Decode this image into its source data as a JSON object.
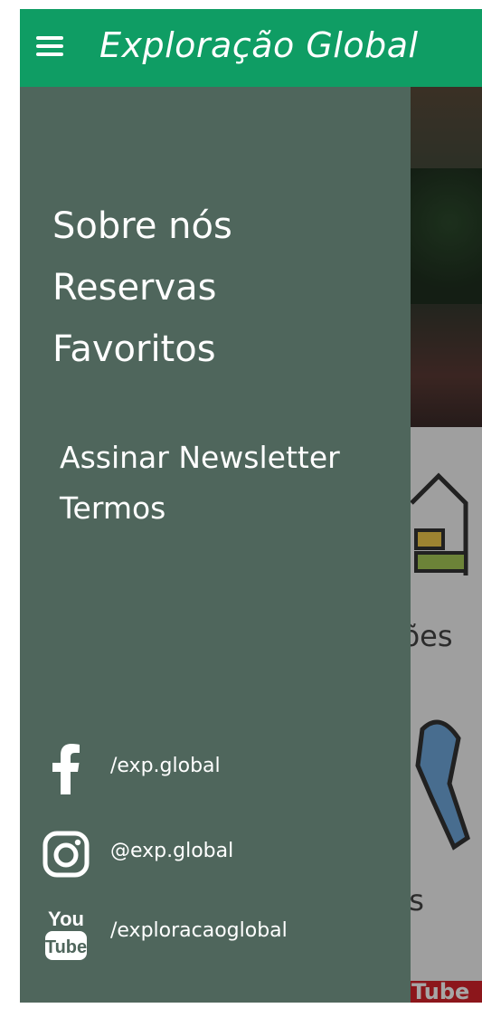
{
  "app": {
    "title": "Exploração Global"
  },
  "drawer": {
    "main_items": [
      {
        "label": "Sobre nós"
      },
      {
        "label": "Reservas"
      },
      {
        "label": "Favoritos"
      }
    ],
    "secondary_items": [
      {
        "label": "Assinar Newsletter"
      },
      {
        "label": "Termos"
      }
    ],
    "social": {
      "facebook": {
        "label": "/exp.global",
        "icon": "facebook-icon"
      },
      "instagram": {
        "label": "@exp.global",
        "icon": "instagram-icon"
      },
      "youtube": {
        "label": "/exploracaoglobal",
        "icon": "youtube-icon",
        "logo_top": "You",
        "logo_bottom": "Tube"
      }
    }
  },
  "background": {
    "card_1_label": "ções",
    "card_2_label": "ns",
    "youtube_text": "Tube"
  },
  "colors": {
    "appbar": "#0f9d64",
    "drawer": "#4f665c",
    "text": "#ffffff"
  }
}
